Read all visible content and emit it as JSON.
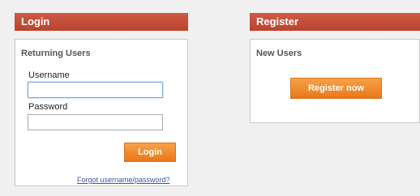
{
  "login": {
    "header": "Login",
    "subheading": "Returning Users",
    "username_label": "Username",
    "username_value": "",
    "password_label": "Password",
    "password_value": "",
    "button_label": "Login",
    "forgot_link": "Forgot username/password?"
  },
  "register": {
    "header": "Register",
    "subheading": "New Users",
    "button_label": "Register now"
  },
  "colors": {
    "header_red": "#c24b37",
    "button_orange": "#f0862a",
    "link_blue": "#3b57a0"
  }
}
